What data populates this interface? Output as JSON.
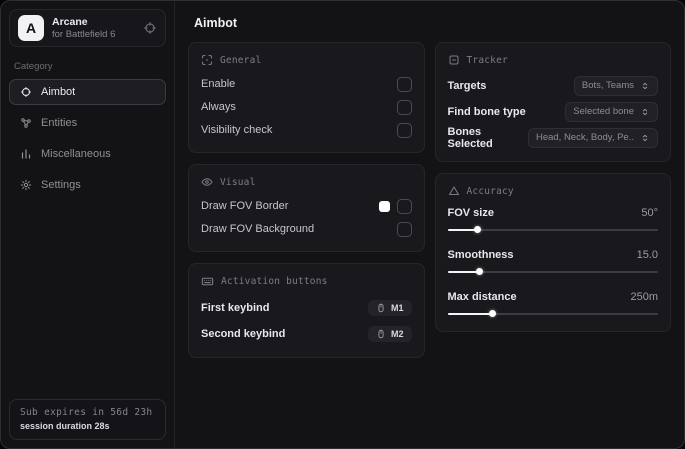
{
  "sidebar": {
    "logo_letter": "A",
    "app_name": "Arcane",
    "app_subtitle": "for Battlefield 6",
    "category_label": "Category",
    "items": [
      {
        "label": "Aimbot",
        "icon": "crosshair-icon",
        "selected": true
      },
      {
        "label": "Entities",
        "icon": "entities-icon",
        "selected": false
      },
      {
        "label": "Miscellaneous",
        "icon": "bars-icon",
        "selected": false
      },
      {
        "label": "Settings",
        "icon": "gear-icon",
        "selected": false
      }
    ],
    "status": {
      "line1": "Sub expires in 56d 23h",
      "line2": "session duration 28s"
    }
  },
  "main": {
    "title": "Aimbot",
    "cards": {
      "general": {
        "title": "General",
        "rows": [
          {
            "label": "Enable",
            "checked": false
          },
          {
            "label": "Always",
            "checked": false
          },
          {
            "label": "Visibility check",
            "checked": false
          }
        ]
      },
      "visual": {
        "title": "Visual",
        "rows": [
          {
            "label": "Draw FOV Border",
            "swatch": "#ffffff",
            "checked": false
          },
          {
            "label": "Draw FOV Background",
            "checked": false
          }
        ]
      },
      "activation": {
        "title": "Activation buttons",
        "rows": [
          {
            "label": "First keybind",
            "key": "M1"
          },
          {
            "label": "Second keybind",
            "key": "M2"
          }
        ]
      },
      "tracker": {
        "title": "Tracker",
        "rows": [
          {
            "label": "Targets",
            "value": "Bots, Teams"
          },
          {
            "label": "Find bone type",
            "value": "Selected bone"
          },
          {
            "label": "Bones Selected",
            "value": "Head, Neck, Body, Pe.."
          }
        ]
      },
      "accuracy": {
        "title": "Accuracy",
        "rows": [
          {
            "label": "FOV size",
            "value": "50°",
            "percent": 14
          },
          {
            "label": "Smoothness",
            "value": "15.0",
            "percent": 15
          },
          {
            "label": "Max distance",
            "value": "250m",
            "percent": 21
          }
        ]
      }
    }
  },
  "colors": {
    "accent_swatch": "#ffffff",
    "card_bg": "#19191d",
    "window_bg": "#131316"
  }
}
